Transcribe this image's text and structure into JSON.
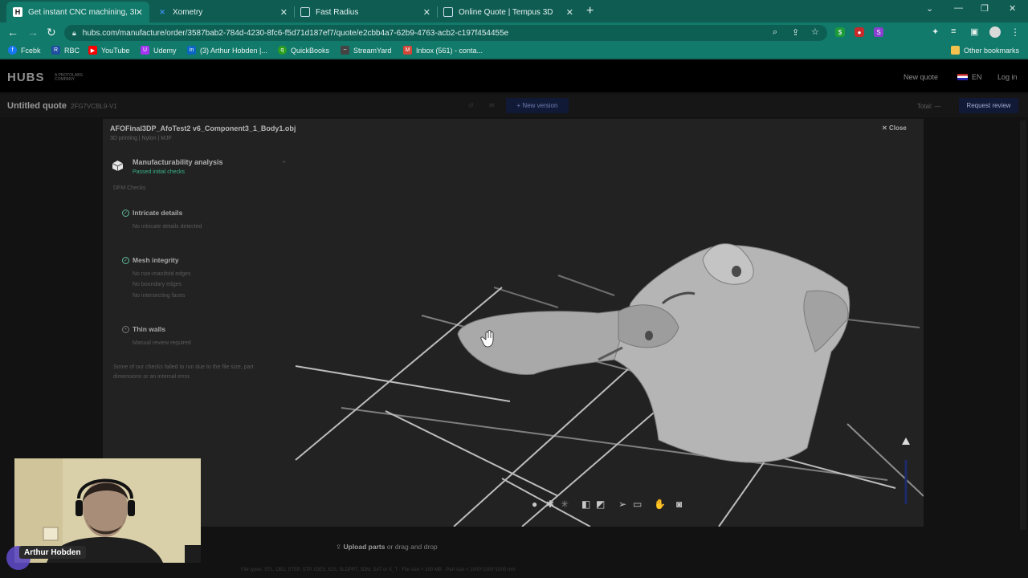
{
  "browser": {
    "tabs": [
      {
        "title": "Get instant CNC machining, 3D p",
        "icon": "hubs-favicon",
        "active": true
      },
      {
        "title": "Xometry",
        "icon": "xometry-favicon",
        "active": false
      },
      {
        "title": "Fast Radius",
        "icon": "fastradius-favicon",
        "active": false
      },
      {
        "title": "Online Quote | Tempus 3D",
        "icon": "tempus-favicon",
        "active": false
      }
    ],
    "url": "hubs.com/manufacture/order/3587bab2-784d-4230-8fc6-f5d71d187ef7/quote/e2cbb4a7-62b9-4763-acb2-c197f454455e",
    "bookmarks": [
      {
        "label": "Fcebk",
        "icon": "facebook-icon",
        "color": "#1877f2"
      },
      {
        "label": "RBC",
        "icon": "rbc-icon",
        "color": "#1f4fa0"
      },
      {
        "label": "YouTube",
        "icon": "youtube-icon",
        "color": "#ff0000"
      },
      {
        "label": "Udemy",
        "icon": "udemy-icon",
        "color": "#a435f0"
      },
      {
        "label": "(3) Arthur Hobden |...",
        "icon": "linkedin-icon",
        "color": "#0a66c2"
      },
      {
        "label": "QuickBooks",
        "icon": "quickbooks-icon",
        "color": "#2ca01c"
      },
      {
        "label": "StreamYard",
        "icon": "streamyard-icon",
        "color": "#444"
      },
      {
        "label": "Inbox (561) - conta...",
        "icon": "gmail-icon",
        "color": "#d44638"
      }
    ],
    "other_bookmarks": "Other bookmarks"
  },
  "hubs": {
    "logo": "HUBS",
    "logo_sub": "A PROTOLABS COMPANY",
    "new_quote": "New quote",
    "language": "EN",
    "login": "Log in",
    "quote_title": "Untitled quote",
    "quote_id": "2FG7VCBL9-V1",
    "new_version": "+ New version",
    "total": "Total: —",
    "request_review": "Request review"
  },
  "modal": {
    "part_name": "AFOFinal3DP_AfoTest2 v6_Component3_1_Body1.obj",
    "part_spec": "3D printing | Nylon | MJF",
    "close": "Close",
    "analysis_title": "Manufacturability analysis",
    "analysis_status": "Passed initial checks",
    "dfm_label": "DFM Checks",
    "checks": [
      {
        "title": "Intricate details",
        "lines": [
          "No intricate details detected"
        ],
        "status": "pass"
      },
      {
        "title": "Mesh integrity",
        "lines": [
          "No non-manifold edges",
          "No boundary edges",
          "No intersecting faces"
        ],
        "status": "pass"
      },
      {
        "title": "Thin walls",
        "lines": [
          "Manual review required"
        ],
        "status": "pending"
      }
    ],
    "note": "Some of our checks failed to run due to the file size, part dimensions or an internal error."
  },
  "upload": {
    "label": "Upload parts",
    "suffix": "or drag and drop",
    "fineprint": "File types: STL, OBJ, STEP, STP, IGES, IGS, SLDPRT, 3DM, SAT or X_T · File size < 100 MB · Part size < 1000*1000*1000 mm"
  },
  "webcam": {
    "name": "Arthur Hobden"
  },
  "colors": {
    "tab_strip": "#0e5c52",
    "toolbar": "#127a6b",
    "accent_green": "#39b38d",
    "button_navy": "#101a37"
  }
}
